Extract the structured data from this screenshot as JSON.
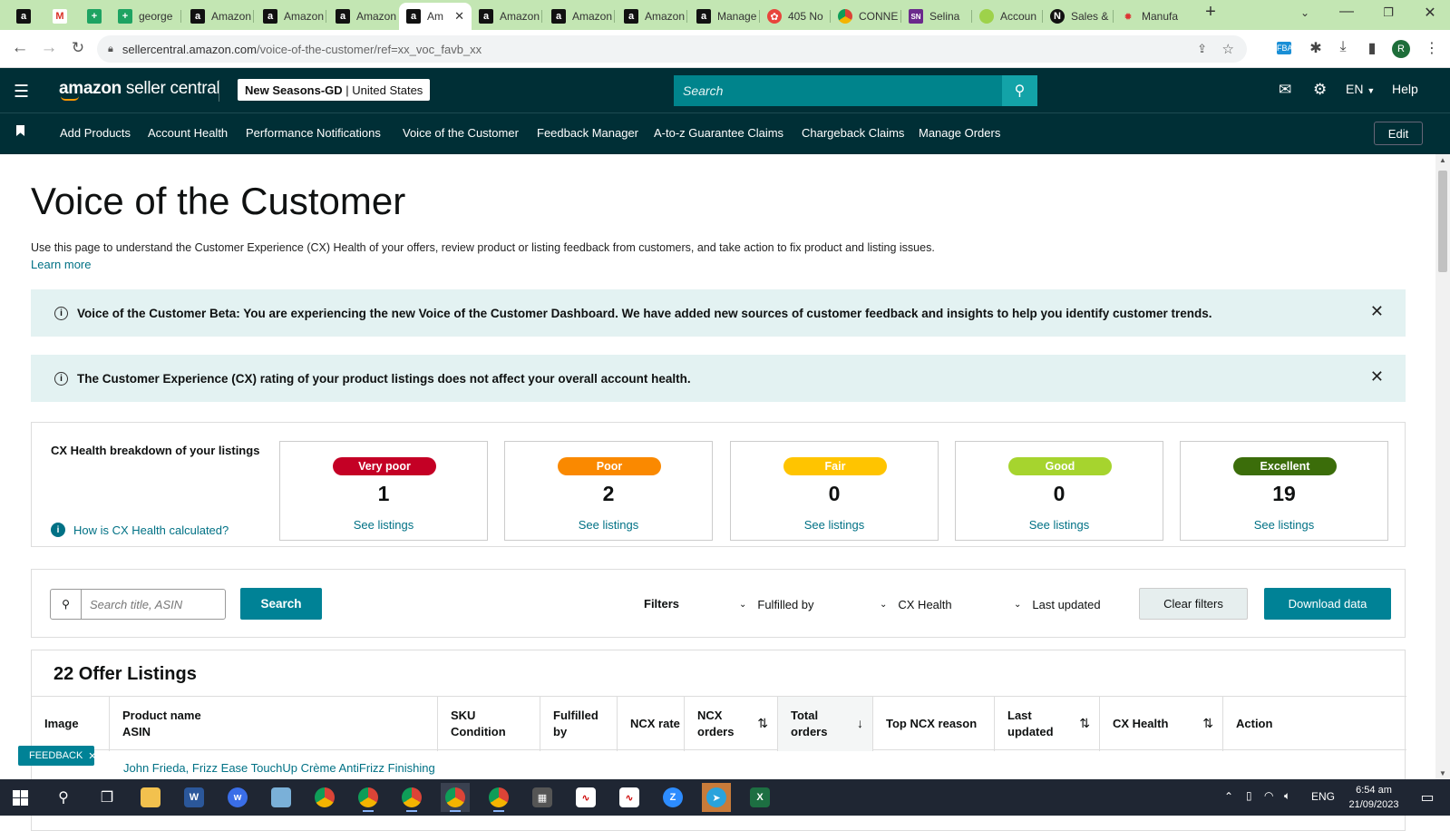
{
  "browser": {
    "tabs": [
      {
        "icon": "amazon-favicon",
        "label": ""
      },
      {
        "icon": "gmail-favicon",
        "label": ""
      },
      {
        "icon": "sheets-favicon",
        "label": ""
      },
      {
        "icon": "sheets-favicon",
        "label": "george"
      },
      {
        "icon": "amazon-favicon",
        "label": "Amazon"
      },
      {
        "icon": "amazon-favicon",
        "label": "Amazon"
      },
      {
        "icon": "amazon-favicon",
        "label": "Amazon"
      },
      {
        "icon": "amazon-favicon",
        "label": "Am"
      },
      {
        "icon": "amazon-favicon",
        "label": "Amazon"
      },
      {
        "icon": "amazon-favicon",
        "label": "Amazon"
      },
      {
        "icon": "amazon-favicon",
        "label": "Amazon"
      },
      {
        "icon": "amazon-favicon",
        "label": "Manage"
      },
      {
        "icon": "leaf-favicon",
        "label": "405 No"
      },
      {
        "icon": "chrome-favicon",
        "label": "CONNE"
      },
      {
        "icon": "sn-favicon",
        "label": "Selina"
      },
      {
        "icon": "green-circle-favicon",
        "label": "Accoun"
      },
      {
        "icon": "n-favicon",
        "label": "Sales &"
      },
      {
        "icon": "gear-red-favicon",
        "label": "Manufa"
      }
    ],
    "url_host": "sellercentral.amazon.com",
    "url_path": "/voice-of-the-customer/ref=xx_voc_favb_xx"
  },
  "header": {
    "logo_brand": "amazon",
    "logo_rest": " seller central",
    "account_name": "New Seasons-GD",
    "account_sep": " | ",
    "account_region": "United States",
    "search_placeholder": "Search",
    "lang": "EN",
    "help": "Help"
  },
  "nav": {
    "items": [
      "Add Products",
      "Account Health",
      "Performance Notifications",
      "Voice of the Customer",
      "Feedback Manager",
      "A-to-z Guarantee Claims",
      "Chargeback Claims",
      "Manage Orders"
    ],
    "edit": "Edit"
  },
  "page": {
    "title": "Voice of the Customer",
    "description": "Use this page to understand the Customer Experience (CX) Health of your offers, review product or listing feedback from customers, and take action to fix product and listing issues.",
    "learn_more": "Learn more",
    "banner1": "Voice of the Customer Beta: You are experiencing the new Voice of the Customer Dashboard. We have added new sources of customer feedback and insights to help you identify customer trends.",
    "banner2": "The Customer Experience (CX) rating of your product listings does not affect your overall account health."
  },
  "cx": {
    "title": "CX Health breakdown of your listings",
    "how": "How is CX Health calculated?",
    "cards": [
      {
        "label": "Very poor",
        "count": "1",
        "color": "#c40025",
        "link": "See listings"
      },
      {
        "label": "Poor",
        "count": "2",
        "color": "#fa8900",
        "link": "See listings"
      },
      {
        "label": "Fair",
        "count": "0",
        "color": "#ffc400",
        "link": "See listings"
      },
      {
        "label": "Good",
        "count": "0",
        "color": "#a6d42e",
        "link": "See listings"
      },
      {
        "label": "Excellent",
        "count": "19",
        "color": "#3b6d0a",
        "link": "See listings"
      }
    ]
  },
  "filters": {
    "search_placeholder": "Search title, ASIN",
    "search_button": "Search",
    "filters_label": "Filters",
    "fulfilled_by": "Fulfilled by",
    "cx_health": "CX Health",
    "last_updated": "Last updated",
    "clear": "Clear filters",
    "download": "Download data"
  },
  "listings": {
    "title": "22 Offer Listings",
    "columns": [
      {
        "l1": "Image",
        "l2": ""
      },
      {
        "l1": "Product name",
        "l2": "ASIN"
      },
      {
        "l1": "SKU",
        "l2": "Condition"
      },
      {
        "l1": "Fulfilled",
        "l2": "by"
      },
      {
        "l1": "NCX rate",
        "l2": ""
      },
      {
        "l1": "NCX",
        "l2": "orders"
      },
      {
        "l1": "Total",
        "l2": "orders"
      },
      {
        "l1": "Top NCX reason",
        "l2": ""
      },
      {
        "l1": "Last",
        "l2": "updated"
      },
      {
        "l1": "CX Health",
        "l2": ""
      },
      {
        "l1": "Action",
        "l2": ""
      }
    ],
    "first_row_name": "John Frieda, Frizz Ease TouchUp Crème AntiFrizz Finishing"
  },
  "feedback_tab": "FEEDBACK",
  "taskbar": {
    "lang": "ENG",
    "time": "6:54 am",
    "date": "21/09/2023"
  }
}
